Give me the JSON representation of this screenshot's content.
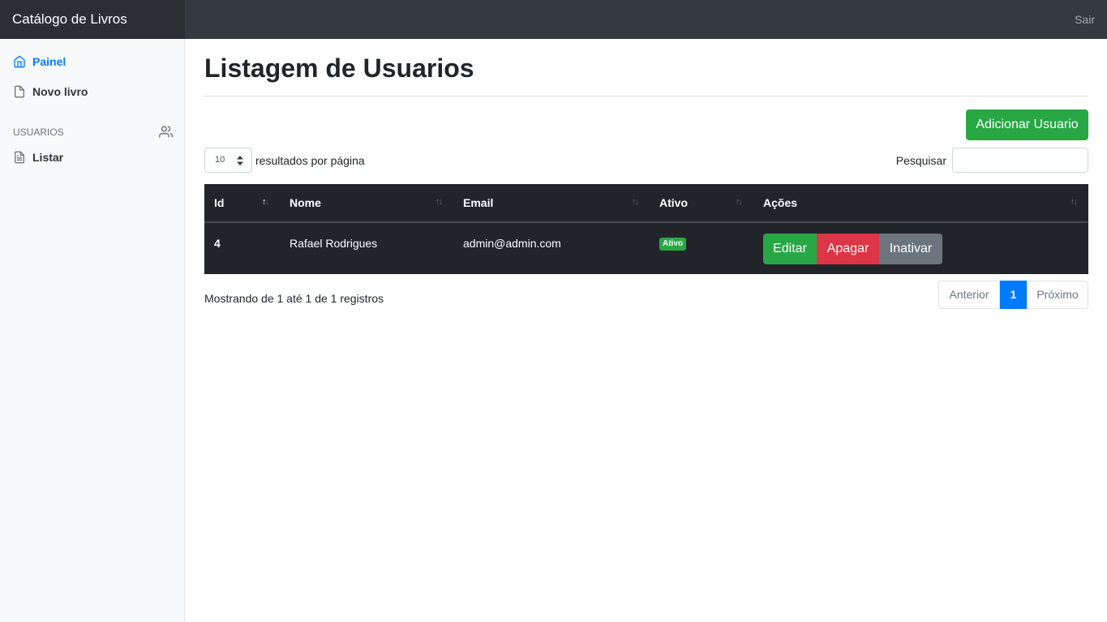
{
  "app": {
    "brand": "Catálogo de Livros",
    "signout": "Sair"
  },
  "sidebar": {
    "items": [
      {
        "label": "Painel",
        "icon": "home-icon",
        "active": true
      },
      {
        "label": "Novo livro",
        "icon": "file-icon"
      }
    ],
    "section_heading": "USUARIOS",
    "section_icon": "users-icon",
    "section_items": [
      {
        "label": "Listar",
        "icon": "file-text-icon"
      }
    ]
  },
  "page": {
    "title": "Listagem de Usuarios",
    "add_button": "Adicionar Usuario",
    "page_length": "10",
    "page_length_suffix": "resultados por página",
    "search_label": "Pesquisar",
    "search_value": ""
  },
  "table": {
    "columns": [
      "Id",
      "Nome",
      "Email",
      "Ativo",
      "Ações"
    ],
    "rows": [
      {
        "id": "4",
        "name": "Rafael Rodrigues",
        "email": "admin@admin.com",
        "status": "Ativo",
        "actions": [
          "Editar",
          "Apagar",
          "Inativar"
        ]
      }
    ]
  },
  "footer": {
    "info": "Mostrando de 1 até 1 de 1 registros",
    "prev": "Anterior",
    "current_page": "1",
    "next": "Próximo"
  },
  "colors": {
    "topbar": "#343a40",
    "success": "#28a745",
    "danger": "#dc3545",
    "secondary": "#6c757d",
    "primary": "#007bff",
    "table_dark": "#212529"
  }
}
